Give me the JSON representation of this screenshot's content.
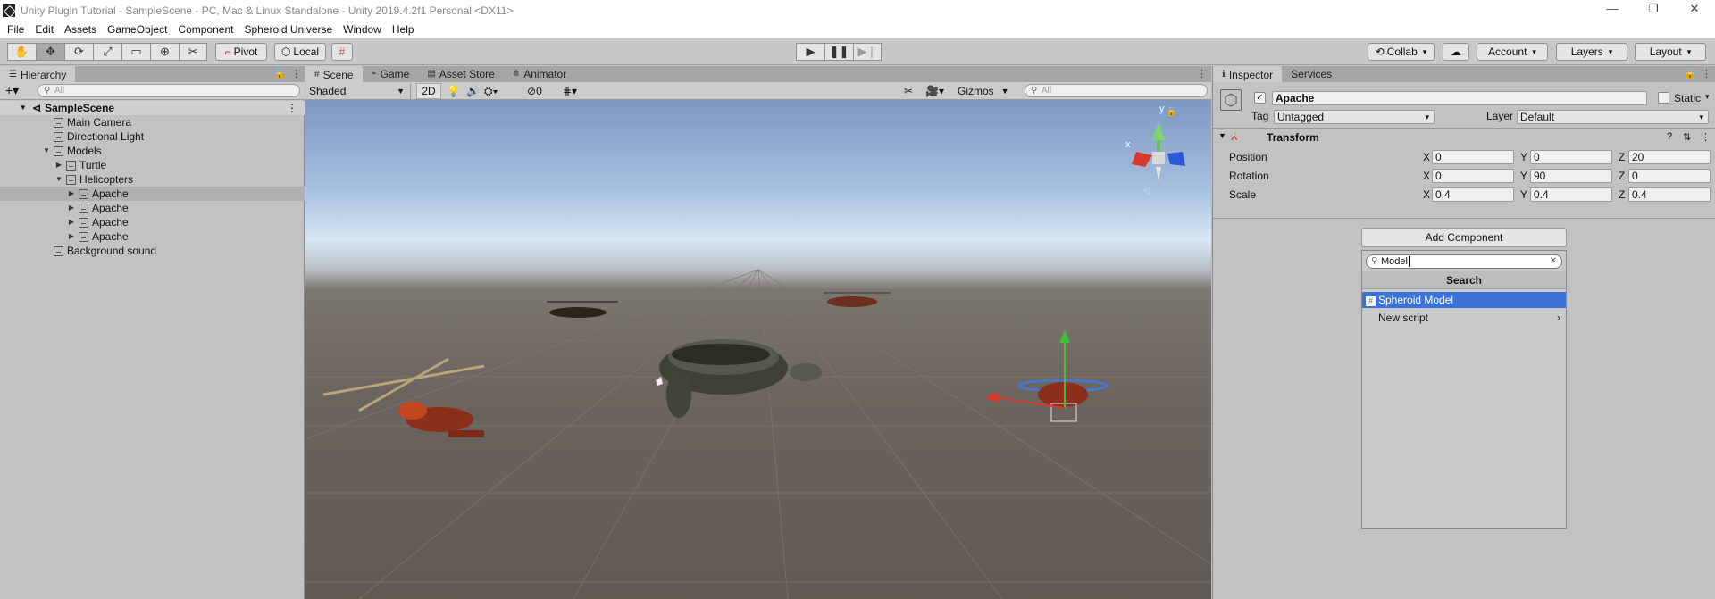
{
  "window": {
    "title": "Unity Plugin Tutorial - SampleScene - PC, Mac & Linux Standalone - Unity 2019.4.2f1 Personal <DX11>",
    "controls": [
      "—",
      "❐",
      "✕"
    ]
  },
  "menu": [
    "File",
    "Edit",
    "Assets",
    "GameObject",
    "Component",
    "Spheroid Universe",
    "Window",
    "Help"
  ],
  "toolbar": {
    "tools": [
      "hand-tool",
      "move-tool",
      "rotate-tool",
      "scale-tool",
      "rect-tool",
      "transform-tool",
      "custom-tool"
    ],
    "pivot_label": "Pivot",
    "local_label": "Local",
    "play_icons": [
      "▶",
      "❚❚",
      "▶❘"
    ],
    "collab_label": "Collab",
    "account_label": "Account",
    "layers_label": "Layers",
    "layout_label": "Layout"
  },
  "hierarchy": {
    "tab_label": "Hierarchy",
    "search_placeholder": "All",
    "rows": [
      {
        "label": "SampleScene",
        "depth": 0,
        "expanded": true,
        "scene": true
      },
      {
        "label": "Main Camera",
        "depth": 1
      },
      {
        "label": "Directional Light",
        "depth": 1
      },
      {
        "label": "Models",
        "depth": 1,
        "expanded": true
      },
      {
        "label": "Turtle",
        "depth": 2,
        "collapsed": true
      },
      {
        "label": "Helicopters",
        "depth": 2,
        "expanded": true
      },
      {
        "label": "Apache",
        "depth": 3,
        "collapsed": true,
        "selected": true
      },
      {
        "label": "Apache",
        "depth": 3,
        "collapsed": true
      },
      {
        "label": "Apache",
        "depth": 3,
        "collapsed": true
      },
      {
        "label": "Apache",
        "depth": 3,
        "collapsed": true
      },
      {
        "label": "Background sound",
        "depth": 1
      }
    ]
  },
  "scene": {
    "tabs": [
      "Scene",
      "Game",
      "Asset Store",
      "Animator"
    ],
    "shading_label": "Shaded",
    "mode_2d_label": "2D",
    "hidden_count": "0",
    "gizmos_label": "Gizmos",
    "search_placeholder": "All",
    "gizmo_axes": {
      "x": "x",
      "y": "y"
    }
  },
  "inspector": {
    "tabs": [
      "Inspector",
      "Services"
    ],
    "object_name": "Apache",
    "static_label": "Static",
    "tag_label": "Tag",
    "tag_value": "Untagged",
    "layer_label": "Layer",
    "layer_value": "Default",
    "transform_title": "Transform",
    "position_label": "Position",
    "rotation_label": "Rotation",
    "scale_label": "Scale",
    "axis_x": "X",
    "axis_y": "Y",
    "axis_z": "Z",
    "position": {
      "x": "0",
      "y": "0",
      "z": "20"
    },
    "rotation": {
      "x": "0",
      "y": "90",
      "z": "0"
    },
    "scale": {
      "x": "0.4",
      "y": "0.4",
      "z": "0.4"
    },
    "add_component_label": "Add Component",
    "popup": {
      "search_value": "Model",
      "header": "Search",
      "items": [
        "Spheroid Model",
        "New script"
      ]
    }
  }
}
